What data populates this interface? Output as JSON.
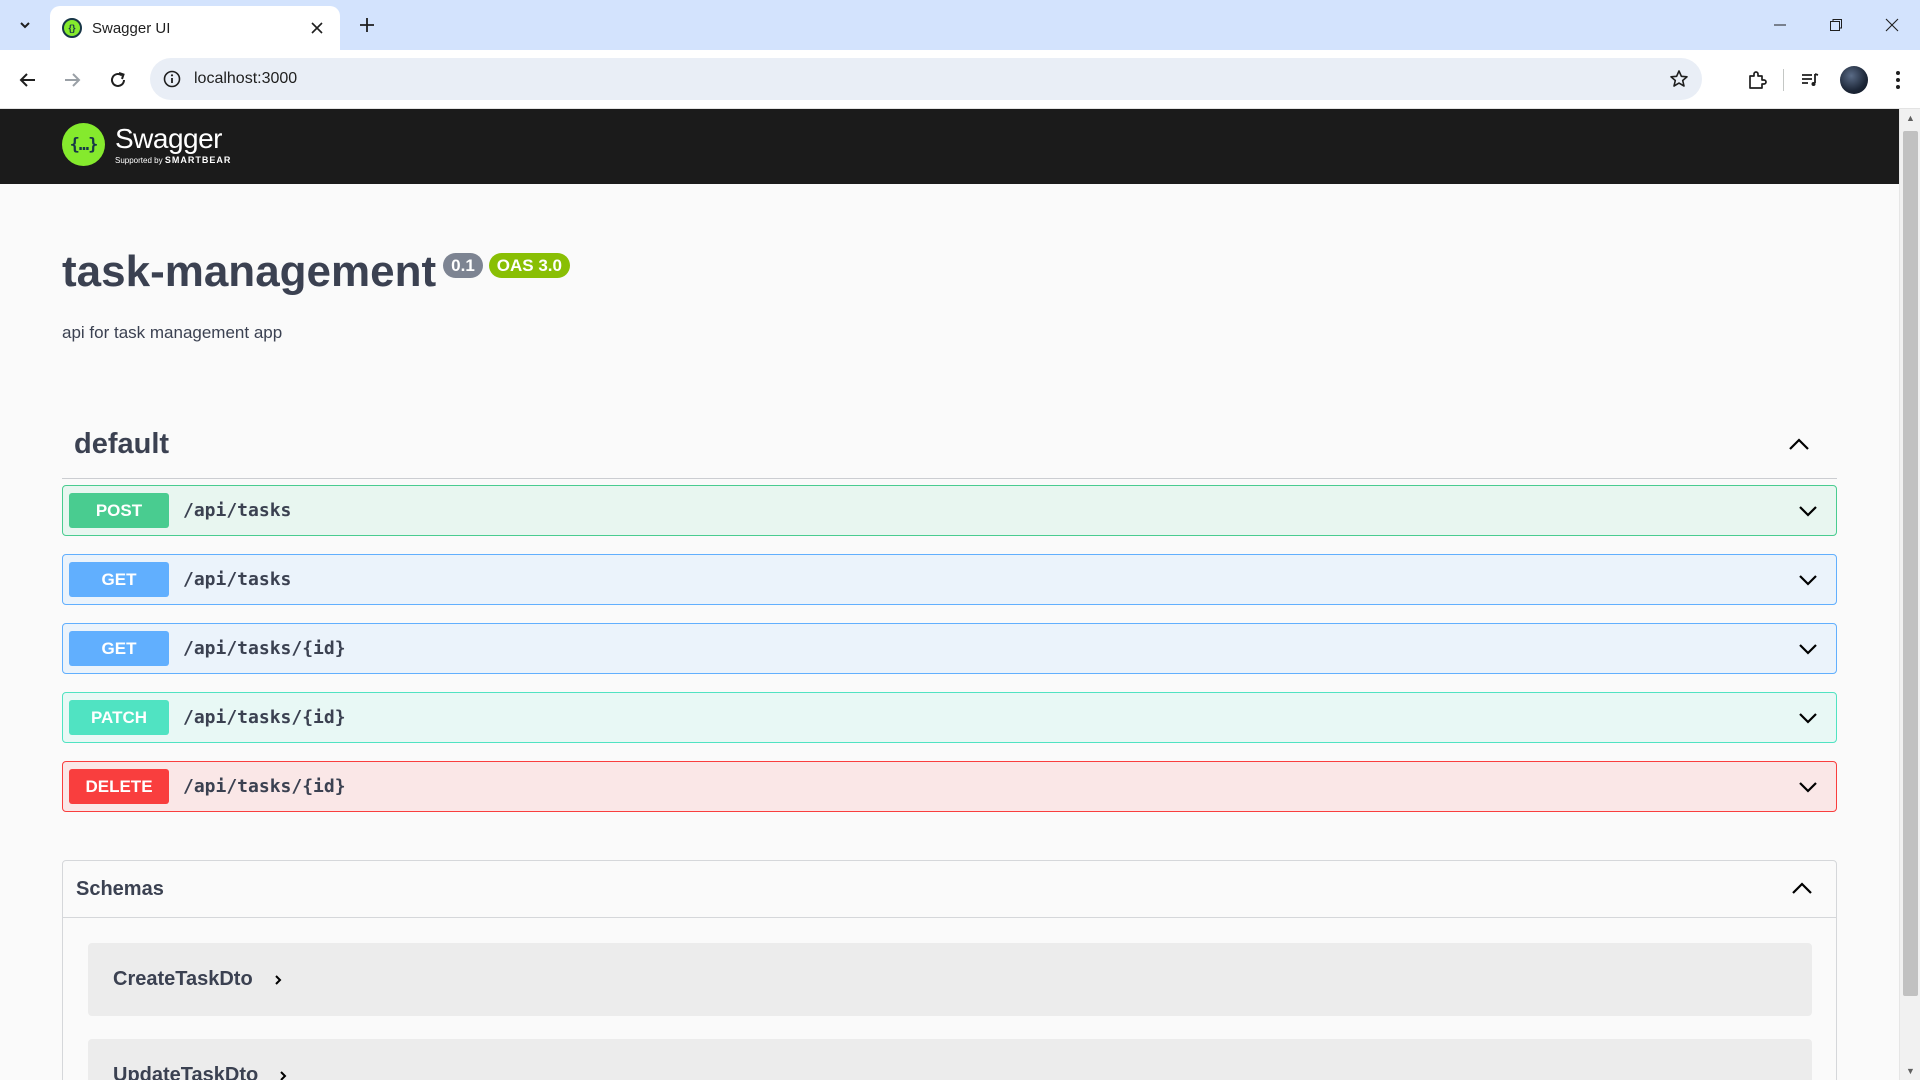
{
  "browser": {
    "tab_title": "Swagger UI",
    "url": "localhost:3000",
    "new_tab_symbol": "+",
    "close_symbol": "✕"
  },
  "swagger": {
    "logo_text": "Swagger",
    "logo_sub_prefix": "Supported by",
    "logo_sub_brand": "SMARTBEAR",
    "logo_glyph": "{…}"
  },
  "info": {
    "title": "task-management",
    "version": "0.1",
    "oas": "OAS 3.0",
    "description": "api for task management app"
  },
  "tag": {
    "name": "default",
    "operations": [
      {
        "method": "POST",
        "path": "/api/tasks",
        "color": "#49cc90",
        "bg": "#e8f6f0",
        "border": "#49cc90"
      },
      {
        "method": "GET",
        "path": "/api/tasks",
        "color": "#61affe",
        "bg": "#ebf3fb",
        "border": "#61affe"
      },
      {
        "method": "GET",
        "path": "/api/tasks/{id}",
        "color": "#61affe",
        "bg": "#ebf3fb",
        "border": "#61affe"
      },
      {
        "method": "PATCH",
        "path": "/api/tasks/{id}",
        "color": "#50e3c2",
        "bg": "#e8f8f5",
        "border": "#50e3c2"
      },
      {
        "method": "DELETE",
        "path": "/api/tasks/{id}",
        "color": "#f93e3e",
        "bg": "#fae7e7",
        "border": "#f93e3e"
      }
    ]
  },
  "schemas": {
    "title": "Schemas",
    "items": [
      "CreateTaskDto",
      "UpdateTaskDto"
    ]
  },
  "icons": {
    "tab_search": "chevron-down-icon",
    "back": "arrow-left-icon",
    "forward": "arrow-right-icon",
    "reload": "reload-icon",
    "site_info": "info-icon",
    "bookmark": "star-icon",
    "extensions": "puzzle-icon",
    "media": "media-control-icon",
    "menu": "more-vertical-icon"
  }
}
